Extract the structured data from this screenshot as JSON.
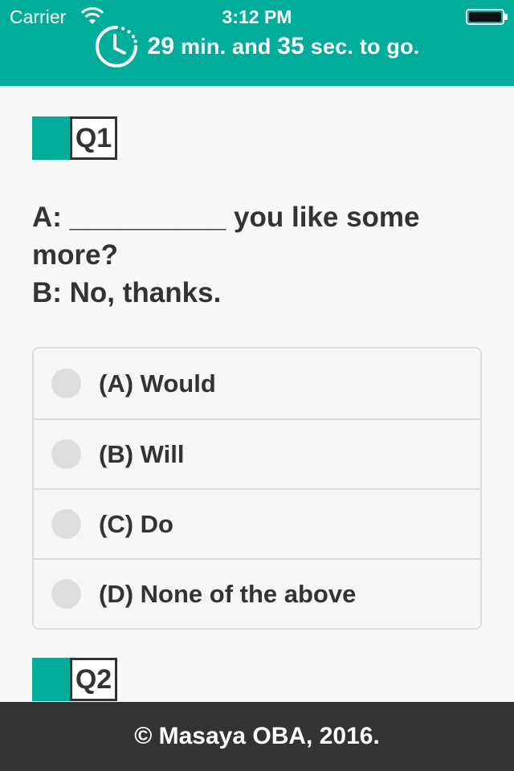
{
  "status_bar": {
    "carrier": "Carrier",
    "time": "3:12 PM"
  },
  "timer": {
    "minutes": "29",
    "min_label": "min. and",
    "seconds": "35",
    "sec_label": "sec. to go.",
    "icon": "clock-countdown-icon"
  },
  "questions": [
    {
      "label": "Q1",
      "prompt_lines": [
        "A: __________ you like some",
        "more?",
        "B: No, thanks."
      ],
      "options": [
        "(A) Would",
        "(B) Will",
        "(C) Do",
        "(D) None of the above"
      ]
    },
    {
      "label": "Q2"
    }
  ],
  "footer": {
    "text": "© Masaya OBA, 2016."
  },
  "colors": {
    "accent": "#00ad9a",
    "text": "#333333",
    "footer_bg": "#333333"
  }
}
